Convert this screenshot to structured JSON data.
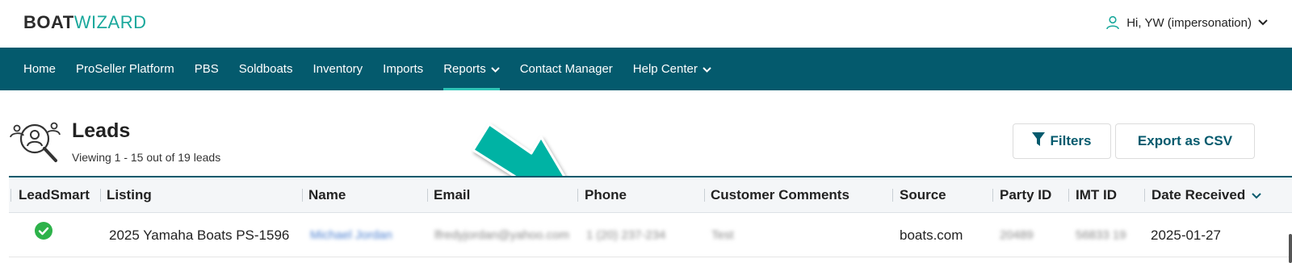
{
  "brand": {
    "part1": "BOAT",
    "part2": "WIZARD"
  },
  "user": {
    "greeting": "Hi, YW (impersonation)",
    "icon": "user-icon"
  },
  "nav": {
    "items": [
      {
        "label": "Home"
      },
      {
        "label": "ProSeller Platform"
      },
      {
        "label": "PBS"
      },
      {
        "label": "Soldboats"
      },
      {
        "label": "Inventory"
      },
      {
        "label": "Imports"
      },
      {
        "label": "Reports",
        "dropdown": true,
        "active": true
      },
      {
        "label": "Contact Manager"
      },
      {
        "label": "Help Center",
        "dropdown": true
      }
    ]
  },
  "page": {
    "title": "Leads",
    "subtitle": "Viewing 1 - 15 out of 19 leads",
    "icon": "leads-search-icon"
  },
  "actions": {
    "filters": "Filters",
    "export": "Export as CSV"
  },
  "table": {
    "columns": [
      "LeadSmart",
      "Listing",
      "Name",
      "Email",
      "Phone",
      "Customer Comments",
      "Source",
      "Party ID",
      "IMT ID",
      "Date Received"
    ],
    "rows": [
      {
        "leadsmart": "check-icon",
        "listing": "2025 Yamaha Boats PS-1596",
        "name": "Michael Jordan",
        "email": "lfredyjordan@yahoo.com",
        "phone": "1 (20) 237-234",
        "comments": "Test",
        "source": "boats.com",
        "party_id": "20489",
        "imt_id": "56833 19",
        "date_received": "2025-01-27"
      }
    ]
  },
  "colors": {
    "nav_bg": "#045a6d",
    "accent": "#1aa89c",
    "arrow": "#00b3a4"
  }
}
